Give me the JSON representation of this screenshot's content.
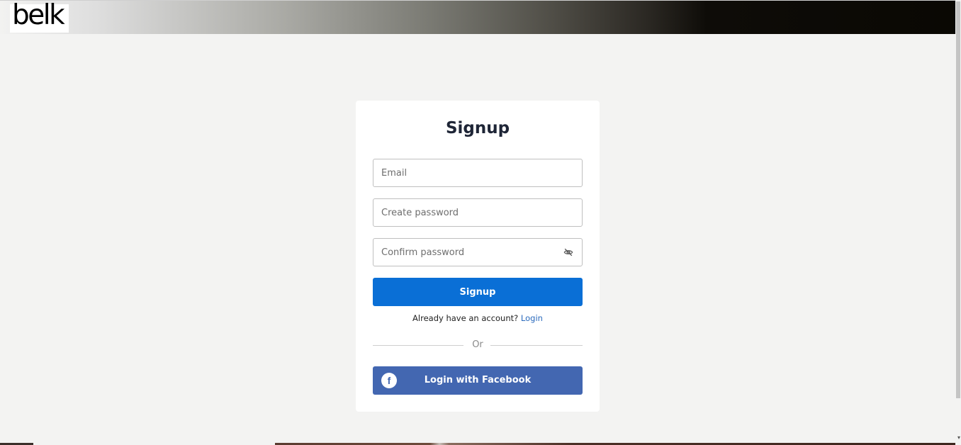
{
  "header": {
    "logo_text": "belk"
  },
  "signup": {
    "title": "Signup",
    "email_placeholder": "Email",
    "create_password_placeholder": "Create password",
    "confirm_password_placeholder": "Confirm password",
    "signup_button": "Signup",
    "already_text": "Already have an account?",
    "login_link": "Login",
    "divider_text": "Or",
    "facebook_button": "Login with Facebook",
    "facebook_icon_glyph": "f"
  },
  "colors": {
    "signup_button_bg": "#0a6fd6",
    "facebook_button_bg": "#4367b1",
    "login_link": "#2c6bbd"
  },
  "icons": {
    "password_toggle": "eye-off-icon",
    "facebook": "facebook-icon"
  }
}
